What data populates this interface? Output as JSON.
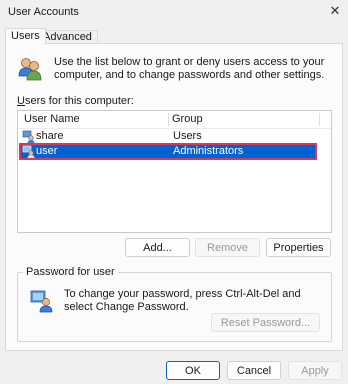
{
  "window": {
    "title": "User Accounts",
    "close_glyph": "✕"
  },
  "tabs": [
    {
      "label": "Users",
      "active": true
    },
    {
      "label": "Advanced",
      "active": false
    }
  ],
  "intro_text": "Use the list below to grant or deny users access to your computer, and to change passwords and other settings.",
  "users_label": "Users for this computer:",
  "list": {
    "columns": [
      "User Name",
      "Group"
    ],
    "rows": [
      {
        "name": "share",
        "group": "Users",
        "selected": false
      },
      {
        "name": "user",
        "group": "Administrators",
        "selected": true
      }
    ]
  },
  "buttons": {
    "add": "Add...",
    "remove": "Remove",
    "properties": "Properties",
    "reset_password": "Reset Password...",
    "ok": "OK",
    "cancel": "Cancel",
    "apply": "Apply"
  },
  "password_group": {
    "legend": "Password for user",
    "text": "To change your password, press Ctrl-Alt-Del and select Change Password."
  },
  "colors": {
    "selection": "#0063d1",
    "selection_outline": "#d63a5a",
    "background": "#f0f0f0",
    "panel": "#fbfbfb"
  }
}
